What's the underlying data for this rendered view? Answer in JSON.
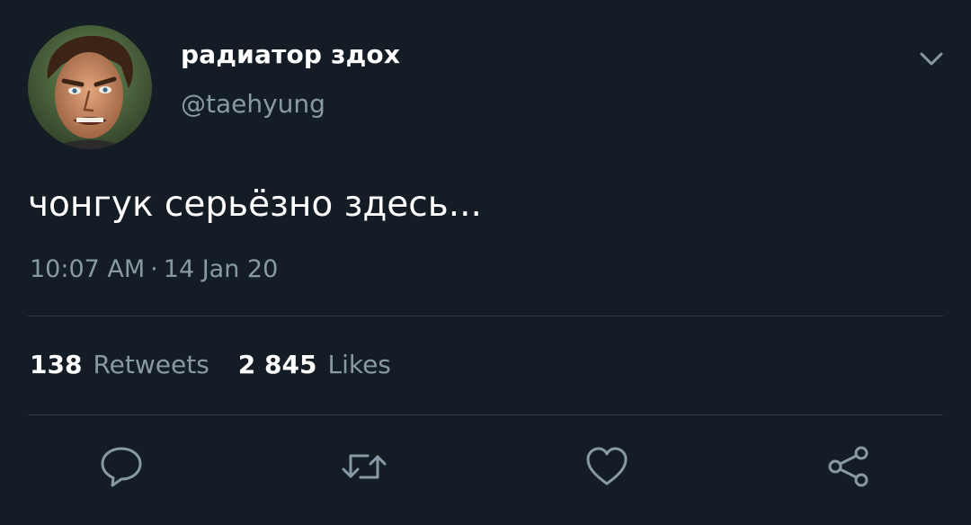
{
  "tweet": {
    "author": {
      "display_name": "радиатор здох",
      "handle": "@taehyung",
      "avatar_icon": "cartoon-face-avatar"
    },
    "text": "чонгук серьёзно здесь...",
    "time": "10:07 AM",
    "separator": "·",
    "date": "14 Jan 20",
    "stats": {
      "retweets_count": "138",
      "retweets_label": "Retweets",
      "likes_count": "2 845",
      "likes_label": "Likes"
    },
    "actions": [
      {
        "name": "reply",
        "icon": "speech-bubble-icon"
      },
      {
        "name": "retweet",
        "icon": "retweet-arrows-icon"
      },
      {
        "name": "like",
        "icon": "heart-icon"
      },
      {
        "name": "share",
        "icon": "share-icon"
      }
    ],
    "menu_icon": "chevron-down-icon"
  },
  "colors": {
    "background": "#141d26",
    "primary_text": "#ffffff",
    "secondary_text": "#8899a6",
    "divider": "#2f3d4a",
    "icon": "#8899a6"
  }
}
